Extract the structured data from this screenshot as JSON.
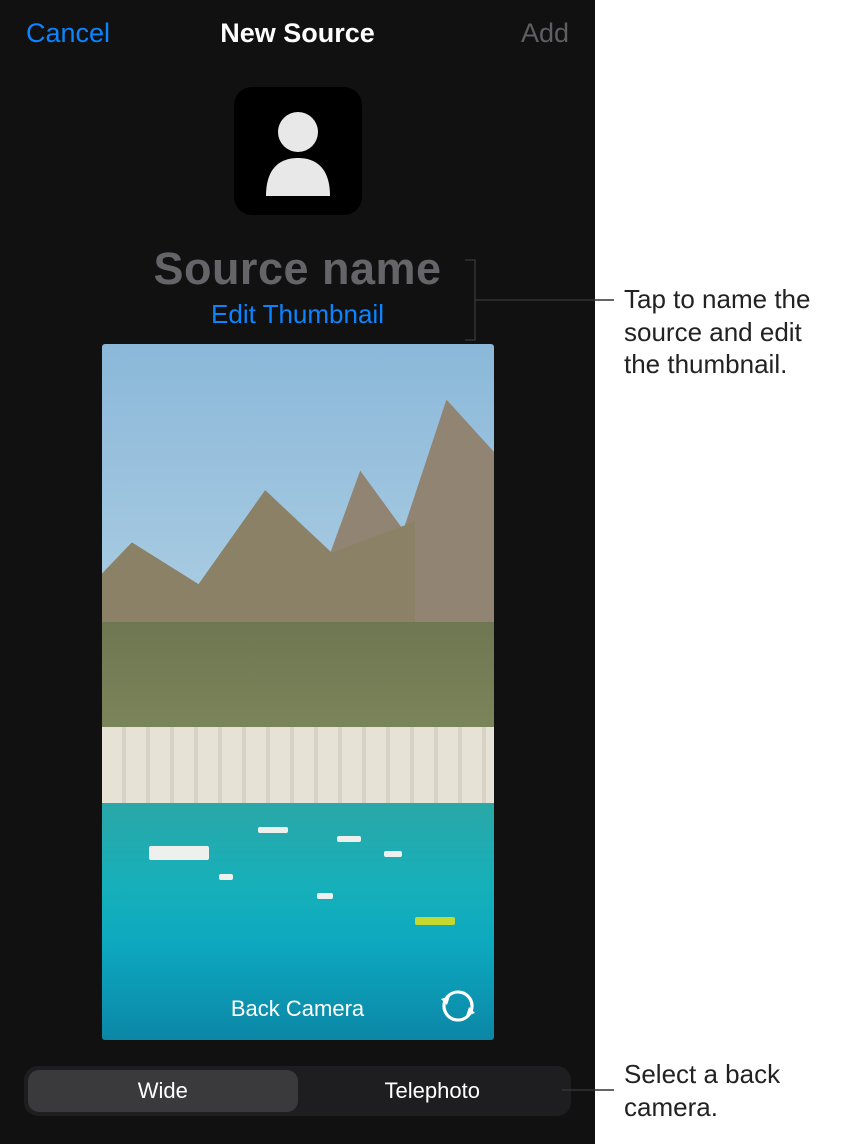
{
  "nav": {
    "cancel": "Cancel",
    "title": "New Source",
    "add": "Add"
  },
  "sourceNamePlaceholder": "Source name",
  "editThumbnail": "Edit Thumbnail",
  "previewLabel": "Back Camera",
  "segments": {
    "wide": "Wide",
    "telephoto": "Telephoto"
  },
  "callouts": {
    "name": "Tap to name the source and edit the thumbnail.",
    "camera": "Select a back camera."
  },
  "colors": {
    "accent": "#0a84ff"
  }
}
